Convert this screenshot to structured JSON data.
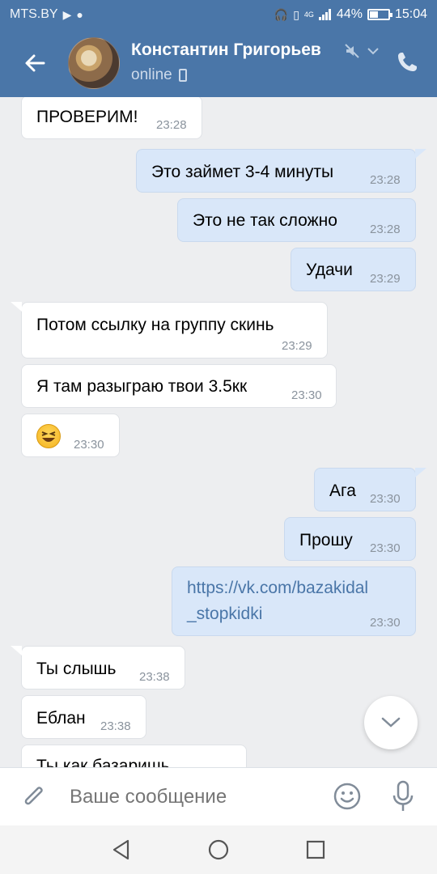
{
  "status_bar": {
    "carrier": "MTS.BY",
    "network": "4G",
    "battery": "44%",
    "battery_level": 0.44,
    "time": "15:04"
  },
  "header": {
    "name": "Константин Григорьев",
    "status": "online"
  },
  "messages": [
    {
      "dir": "in",
      "text": "ПРОВЕРИМ!",
      "time": "23:28"
    },
    {
      "dir": "out",
      "text": "Это займет 3-4 минуты",
      "time": "23:28"
    },
    {
      "dir": "out",
      "text": "Это не так сложно",
      "time": "23:28"
    },
    {
      "dir": "out",
      "text": "Удачи",
      "time": "23:29"
    },
    {
      "dir": "in",
      "text": "Потом ссылку на группу скинь",
      "time": "23:29"
    },
    {
      "dir": "in",
      "text": "Я там разыграю твои 3.5кк",
      "time": "23:30"
    },
    {
      "dir": "in",
      "text": "",
      "emoji": "grinning-squinting-face",
      "time": "23:30"
    },
    {
      "dir": "out",
      "text": "Ага",
      "time": "23:30"
    },
    {
      "dir": "out",
      "text": "Прошу",
      "time": "23:30"
    },
    {
      "dir": "out",
      "text_line1": "https://vk.com/bazakidal",
      "text_line2": "_stopkidki",
      "time": "23:30"
    },
    {
      "dir": "in",
      "text": "Ты слышь",
      "time": "23:38"
    },
    {
      "dir": "in",
      "text": "Еблан",
      "time": "23:38"
    },
    {
      "dir": "in",
      "text": "Ты как базаришь",
      "time": ""
    }
  ],
  "composer": {
    "placeholder": "Ваше сообщение"
  },
  "icons": {
    "back": "arrow-left-icon",
    "mute": "muted-bell-icon",
    "call": "phone-icon",
    "attach": "paperclip-icon",
    "smile": "smile-icon",
    "mic": "microphone-icon",
    "scroll_down": "chevron-down-icon"
  },
  "colors": {
    "header": "#4a76a8",
    "chat_bg": "#edeef0",
    "outgoing_bubble": "#d9e7f9",
    "incoming_bubble": "#ffffff",
    "link": "#4a76a8"
  }
}
